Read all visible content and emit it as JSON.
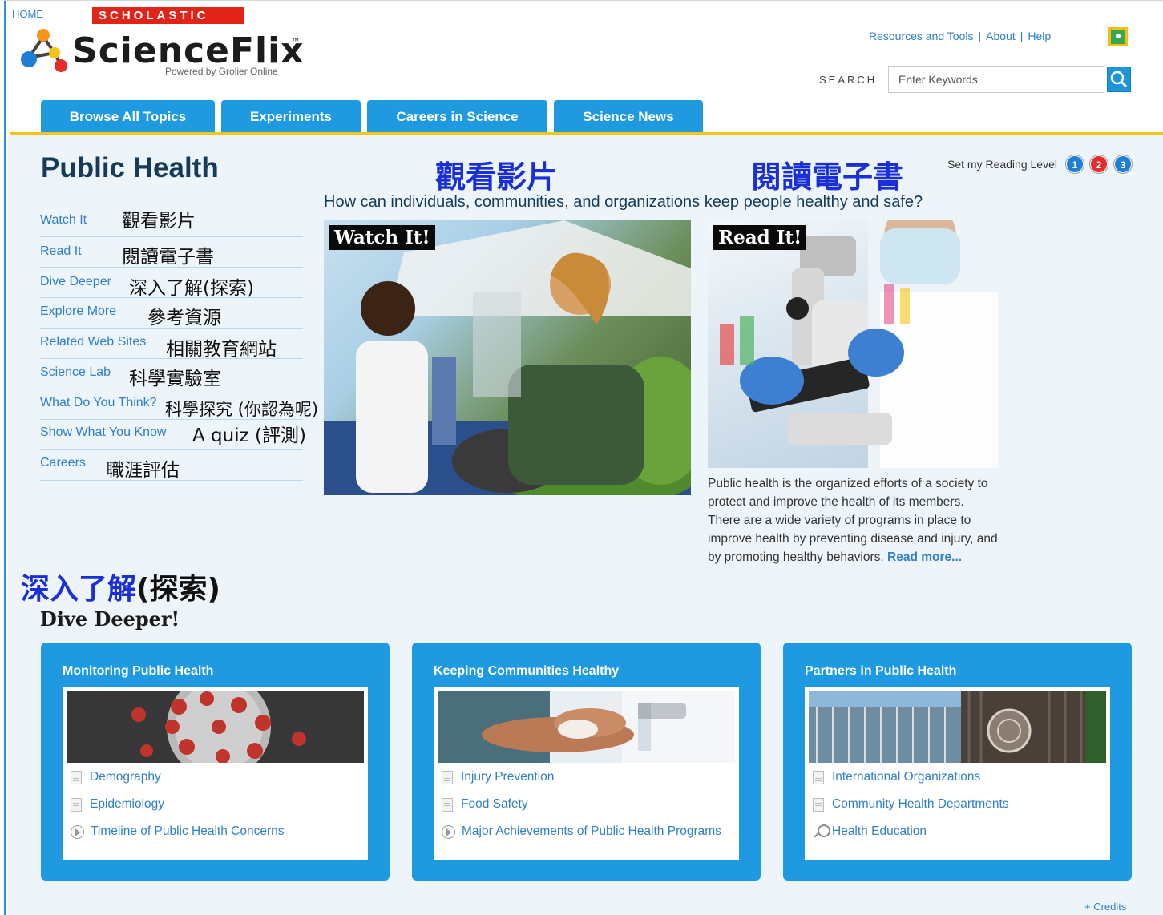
{
  "header": {
    "home_label": "HOME",
    "publisher": "SCHOLASTIC",
    "app_name": "ScienceFlix",
    "trademark": "™",
    "tagline": "Powered by Grolier Online",
    "top_links": [
      "Resources and Tools",
      "About",
      "Help"
    ],
    "link_separator": "|",
    "search_label": "SEARCH",
    "search_placeholder": "Enter Keywords"
  },
  "tabs": [
    "Browse All Topics",
    "Experiments",
    "Careers in Science",
    "Science News"
  ],
  "main": {
    "title": "Public Health",
    "cjk_heading_watch": "觀看影片",
    "cjk_heading_read": "閱讀電子書",
    "reading_level_label": "Set my Reading Level",
    "reading_levels": [
      "1",
      "2",
      "3"
    ],
    "question": "How can individuals, communities, and organizations keep people healthy and safe?"
  },
  "left_nav": [
    {
      "label": "Watch It",
      "cjk": "觀看影片"
    },
    {
      "label": "Read It",
      "cjk": "閱讀電子書"
    },
    {
      "label": "Dive Deeper",
      "cjk": "深入了解(探索)"
    },
    {
      "label": "Explore More",
      "cjk": "參考資源"
    },
    {
      "label": "Related Web Sites",
      "cjk": "相關教育網站"
    },
    {
      "label": "Science Lab",
      "cjk": "科學實驗室"
    },
    {
      "label": "What Do You Think?",
      "cjk": "科學探究 (你認為呢)"
    },
    {
      "label": "Show What You Know",
      "cjk": "A quiz (評測)"
    },
    {
      "label": "Careers",
      "cjk": "職涯評估"
    }
  ],
  "hero": {
    "watch_label": "Watch It!",
    "read_label": "Read It!",
    "read_text": "Public health is the organized efforts of a society to protect and improve the health of its members. There are a wide variety of programs in place to improve health by preventing disease and injury, and by promoting healthy behaviors.",
    "read_more": "Read more..."
  },
  "dive": {
    "cjk_heading_blue": "深入了解",
    "cjk_heading_rest": "(探索)",
    "title": "Dive Deeper!",
    "cards": [
      {
        "title": "Monitoring Public Health",
        "links": [
          "Demography",
          "Epidemiology",
          "Timeline of Public Health Concerns"
        ]
      },
      {
        "title": "Keeping Communities Healthy",
        "links": [
          "Injury Prevention",
          "Food Safety",
          "Major Achievements of Public Health Programs"
        ]
      },
      {
        "title": "Partners in Public Health",
        "links": [
          "International Organizations",
          "Community Health Departments",
          "Health Education"
        ]
      }
    ]
  },
  "footer": {
    "credits": "+ Credits"
  },
  "colors": {
    "accent_blue": "#1f9ae0",
    "link_blue": "#2f7fc9",
    "tab_rule_yellow": "#f5c518",
    "scholastic_red": "#e2231a",
    "cjk_blue": "#1a2fd8",
    "level_1": "#1f7fd6",
    "level_2": "#e52b2b",
    "level_3": "#1f7fd6"
  }
}
